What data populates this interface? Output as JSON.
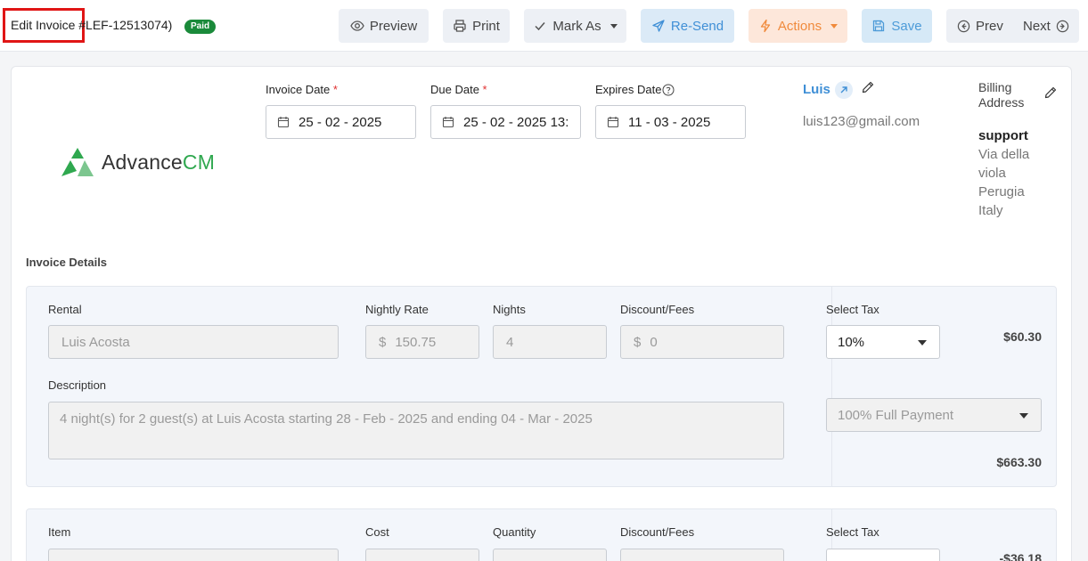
{
  "header": {
    "title": "Edit Invoice",
    "invoice_number": "#LEF-12513074)",
    "status_badge": "Paid",
    "buttons": {
      "preview": "Preview",
      "print": "Print",
      "mark_as": "Mark As",
      "resend": "Re-Send",
      "actions": "Actions",
      "save": "Save",
      "prev": "Prev",
      "next": "Next"
    }
  },
  "logo": {
    "text_main": "Advance",
    "text_accent": "CM"
  },
  "dates": {
    "invoice_date_label": "Invoice Date",
    "invoice_date_value": "25 - 02 - 2025",
    "due_date_label": "Due Date",
    "due_date_value": "25 - 02 - 2025 13:",
    "expires_date_label": "Expires Date",
    "expires_date_value": "11 - 03 - 2025",
    "required_mark": "*"
  },
  "client": {
    "name": "Luis",
    "email": "luis123@gmail.com"
  },
  "billing": {
    "label_line1": "Billing",
    "label_line2": "Address",
    "name": "support",
    "lines": [
      "Via della",
      "viola",
      "Perugia",
      "Italy"
    ]
  },
  "invoice_details": {
    "title": "Invoice Details",
    "rental_line": {
      "rental_label": "Rental",
      "rental_value": "Luis Acosta",
      "rate_label": "Nightly Rate",
      "rate_currency": "$",
      "rate_value": "150.75",
      "nights_label": "Nights",
      "nights_value": "4",
      "discount_label": "Discount/Fees",
      "discount_currency": "$",
      "discount_value": "0",
      "description_label": "Description",
      "description_value": "4 night(s) for 2 guest(s) at Luis Acosta starting 28 - Feb - 2025 and ending 04 - Mar - 2025",
      "tax_label": "Select Tax",
      "tax_value": "10%",
      "tax_amount": "$60.30",
      "payment_value": "100% Full Payment",
      "total_amount": "$663.30"
    },
    "item_line": {
      "item_label": "Item",
      "cost_label": "Cost",
      "quantity_label": "Quantity",
      "discount_label": "Discount/Fees",
      "tax_label": "Select Tax",
      "tax_amount": "-$36.18"
    }
  },
  "colors": {
    "accent_blue": "#3f8fd6",
    "badge_green": "#1a8a3a",
    "logo_green": "#2fa84f",
    "actions_orange": "#f08a3c",
    "highlight_red": "#e01515"
  }
}
